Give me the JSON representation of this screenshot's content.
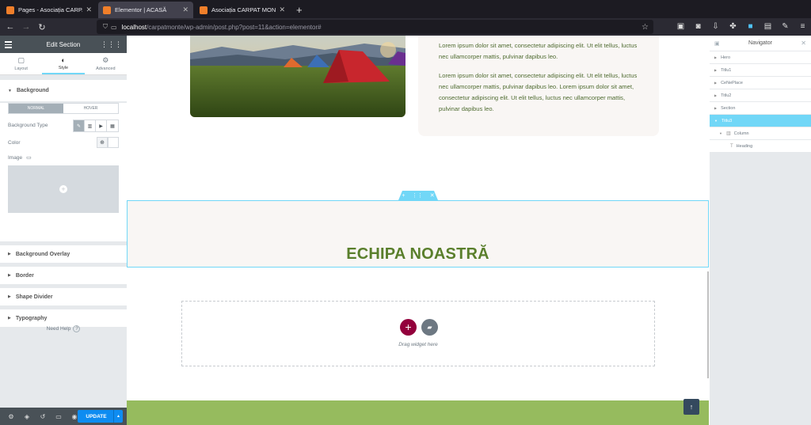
{
  "browser": {
    "tabs": [
      {
        "label": "Pages - Asociația CARPAT MO",
        "active": false
      },
      {
        "label": "Elementor | ACASĂ",
        "active": true
      },
      {
        "label": "Asociația CARPAT MONTE -",
        "active": false
      }
    ],
    "new_tab": "+",
    "url_host": "localhost",
    "url_path": "/carpatmonte/wp-admin/post.php?post=11&action=elementor#"
  },
  "panel": {
    "title": "Edit Section",
    "tabs": [
      {
        "label": "Layout",
        "icon": "layout-icon"
      },
      {
        "label": "Style",
        "icon": "style-icon"
      },
      {
        "label": "Advanced",
        "icon": "gear-icon"
      }
    ],
    "background_section": "Background",
    "normal_label": "NORMAL",
    "hover_label": "HOVER",
    "bg_type_label": "Background Type",
    "color_label": "Color",
    "image_label": "Image",
    "collapsed_sections": [
      "Background Overlay",
      "Border",
      "Shape Divider",
      "Typography"
    ],
    "need_help": "Need Help",
    "update_label": "UPDATE"
  },
  "canvas": {
    "paragraphs": [
      "Lorem ipsum dolor sit amet, consectetur adipiscing elit. Ut elit tellus, luctus nec ullamcorper mattis, pulvinar dapibus leo.",
      "Lorem ipsum dolor sit amet, consectetur adipiscing elit. Ut elit tellus, luctus nec ullamcorper mattis, pulvinar dapibus leo. Lorem ipsum dolor sit amet, consectetur adipiscing elit. Ut elit tellus, luctus nec ullamcorper mattis, pulvinar dapibus leo."
    ],
    "heading": "ECHIPA NOASTRĂ",
    "drag_text": "Drag widget here"
  },
  "navigator": {
    "title": "Navigator",
    "items": [
      {
        "label": "Hero",
        "level": 1
      },
      {
        "label": "Titlu1",
        "level": 1
      },
      {
        "label": "CeNePlace",
        "level": 1
      },
      {
        "label": "Titlu2",
        "level": 1
      },
      {
        "label": "Section",
        "level": 1
      },
      {
        "label": "Titlu3",
        "level": 1,
        "selected": true
      },
      {
        "label": "Column",
        "level": 2
      },
      {
        "label": "Heading",
        "level": 3
      }
    ]
  },
  "colors": {
    "accent": "#71d7f7",
    "heading_green": "#5a7f2c",
    "footer_green": "#96bb5e",
    "update_blue": "#0e8cf1",
    "add_button": "#93003c"
  }
}
